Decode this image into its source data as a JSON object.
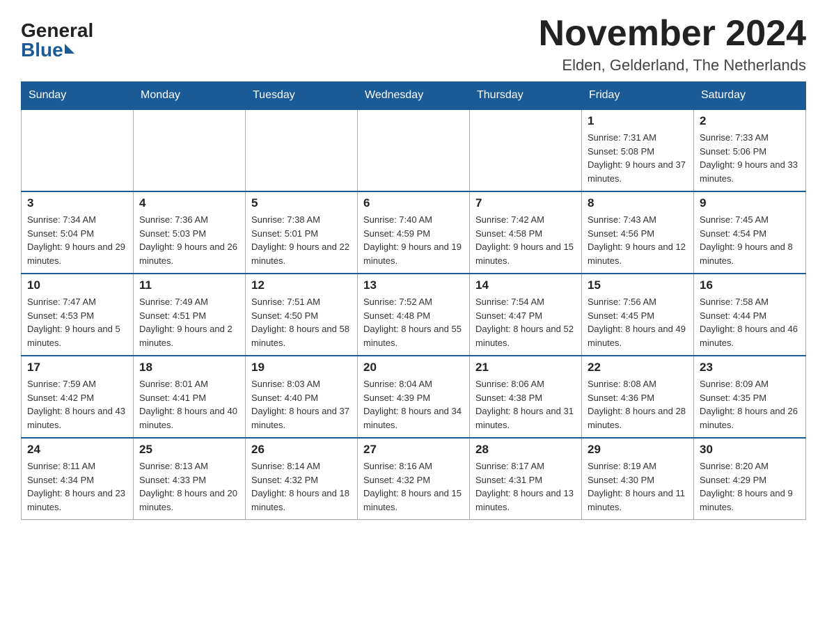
{
  "logo": {
    "general": "General",
    "blue": "Blue"
  },
  "header": {
    "month": "November 2024",
    "location": "Elden, Gelderland, The Netherlands"
  },
  "days_of_week": [
    "Sunday",
    "Monday",
    "Tuesday",
    "Wednesday",
    "Thursday",
    "Friday",
    "Saturday"
  ],
  "weeks": [
    [
      {
        "day": "",
        "info": ""
      },
      {
        "day": "",
        "info": ""
      },
      {
        "day": "",
        "info": ""
      },
      {
        "day": "",
        "info": ""
      },
      {
        "day": "",
        "info": ""
      },
      {
        "day": "1",
        "info": "Sunrise: 7:31 AM\nSunset: 5:08 PM\nDaylight: 9 hours and 37 minutes."
      },
      {
        "day": "2",
        "info": "Sunrise: 7:33 AM\nSunset: 5:06 PM\nDaylight: 9 hours and 33 minutes."
      }
    ],
    [
      {
        "day": "3",
        "info": "Sunrise: 7:34 AM\nSunset: 5:04 PM\nDaylight: 9 hours and 29 minutes."
      },
      {
        "day": "4",
        "info": "Sunrise: 7:36 AM\nSunset: 5:03 PM\nDaylight: 9 hours and 26 minutes."
      },
      {
        "day": "5",
        "info": "Sunrise: 7:38 AM\nSunset: 5:01 PM\nDaylight: 9 hours and 22 minutes."
      },
      {
        "day": "6",
        "info": "Sunrise: 7:40 AM\nSunset: 4:59 PM\nDaylight: 9 hours and 19 minutes."
      },
      {
        "day": "7",
        "info": "Sunrise: 7:42 AM\nSunset: 4:58 PM\nDaylight: 9 hours and 15 minutes."
      },
      {
        "day": "8",
        "info": "Sunrise: 7:43 AM\nSunset: 4:56 PM\nDaylight: 9 hours and 12 minutes."
      },
      {
        "day": "9",
        "info": "Sunrise: 7:45 AM\nSunset: 4:54 PM\nDaylight: 9 hours and 8 minutes."
      }
    ],
    [
      {
        "day": "10",
        "info": "Sunrise: 7:47 AM\nSunset: 4:53 PM\nDaylight: 9 hours and 5 minutes."
      },
      {
        "day": "11",
        "info": "Sunrise: 7:49 AM\nSunset: 4:51 PM\nDaylight: 9 hours and 2 minutes."
      },
      {
        "day": "12",
        "info": "Sunrise: 7:51 AM\nSunset: 4:50 PM\nDaylight: 8 hours and 58 minutes."
      },
      {
        "day": "13",
        "info": "Sunrise: 7:52 AM\nSunset: 4:48 PM\nDaylight: 8 hours and 55 minutes."
      },
      {
        "day": "14",
        "info": "Sunrise: 7:54 AM\nSunset: 4:47 PM\nDaylight: 8 hours and 52 minutes."
      },
      {
        "day": "15",
        "info": "Sunrise: 7:56 AM\nSunset: 4:45 PM\nDaylight: 8 hours and 49 minutes."
      },
      {
        "day": "16",
        "info": "Sunrise: 7:58 AM\nSunset: 4:44 PM\nDaylight: 8 hours and 46 minutes."
      }
    ],
    [
      {
        "day": "17",
        "info": "Sunrise: 7:59 AM\nSunset: 4:42 PM\nDaylight: 8 hours and 43 minutes."
      },
      {
        "day": "18",
        "info": "Sunrise: 8:01 AM\nSunset: 4:41 PM\nDaylight: 8 hours and 40 minutes."
      },
      {
        "day": "19",
        "info": "Sunrise: 8:03 AM\nSunset: 4:40 PM\nDaylight: 8 hours and 37 minutes."
      },
      {
        "day": "20",
        "info": "Sunrise: 8:04 AM\nSunset: 4:39 PM\nDaylight: 8 hours and 34 minutes."
      },
      {
        "day": "21",
        "info": "Sunrise: 8:06 AM\nSunset: 4:38 PM\nDaylight: 8 hours and 31 minutes."
      },
      {
        "day": "22",
        "info": "Sunrise: 8:08 AM\nSunset: 4:36 PM\nDaylight: 8 hours and 28 minutes."
      },
      {
        "day": "23",
        "info": "Sunrise: 8:09 AM\nSunset: 4:35 PM\nDaylight: 8 hours and 26 minutes."
      }
    ],
    [
      {
        "day": "24",
        "info": "Sunrise: 8:11 AM\nSunset: 4:34 PM\nDaylight: 8 hours and 23 minutes."
      },
      {
        "day": "25",
        "info": "Sunrise: 8:13 AM\nSunset: 4:33 PM\nDaylight: 8 hours and 20 minutes."
      },
      {
        "day": "26",
        "info": "Sunrise: 8:14 AM\nSunset: 4:32 PM\nDaylight: 8 hours and 18 minutes."
      },
      {
        "day": "27",
        "info": "Sunrise: 8:16 AM\nSunset: 4:32 PM\nDaylight: 8 hours and 15 minutes."
      },
      {
        "day": "28",
        "info": "Sunrise: 8:17 AM\nSunset: 4:31 PM\nDaylight: 8 hours and 13 minutes."
      },
      {
        "day": "29",
        "info": "Sunrise: 8:19 AM\nSunset: 4:30 PM\nDaylight: 8 hours and 11 minutes."
      },
      {
        "day": "30",
        "info": "Sunrise: 8:20 AM\nSunset: 4:29 PM\nDaylight: 8 hours and 9 minutes."
      }
    ]
  ]
}
